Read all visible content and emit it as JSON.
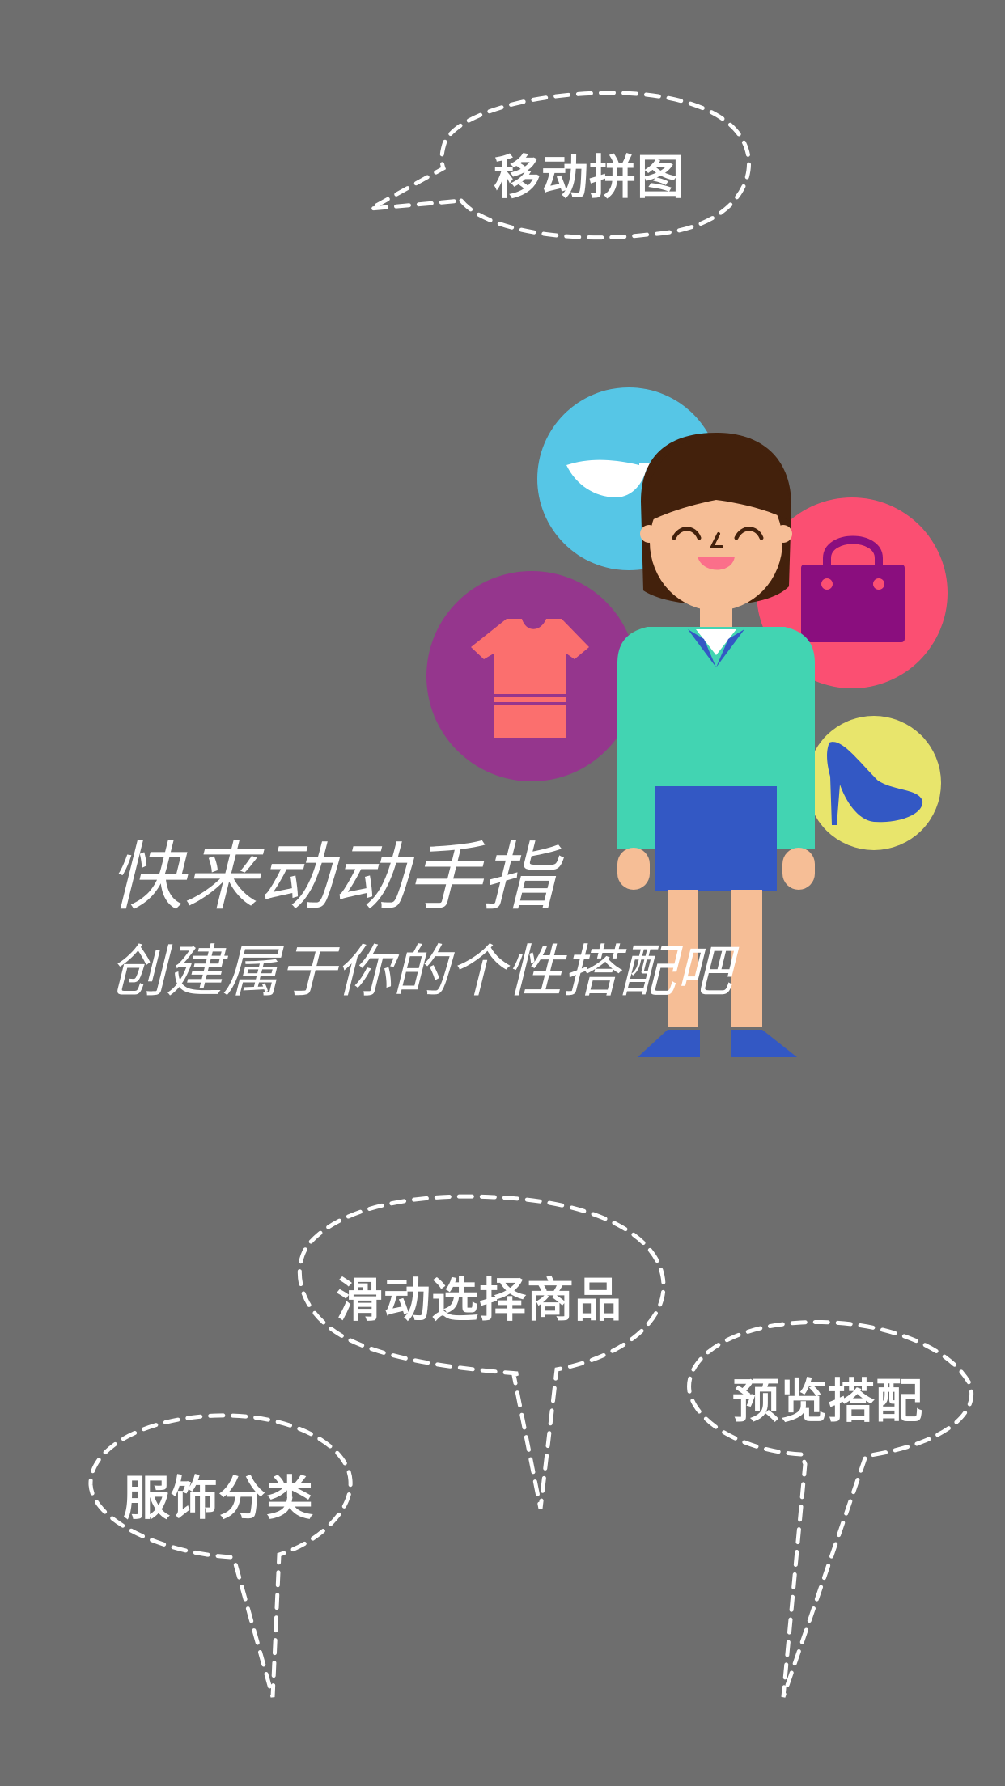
{
  "background": "#6e6e6e",
  "bubbles": {
    "top": "移动拼图",
    "middle": "滑动选择商品",
    "right": "预览搭配",
    "left": "服饰分类"
  },
  "headline": {
    "line1": "快来动动手指",
    "line2": "创建属于你的个性搭配吧"
  },
  "icons": {
    "glasses": "sunglasses-icon",
    "bag": "handbag-icon",
    "shirt": "tshirt-icon",
    "heel": "high-heel-icon"
  },
  "colors": {
    "glasses_circle": "#56c6e6",
    "bag_circle": "#fb4f72",
    "shirt_circle": "#95368d",
    "heel_circle": "#e8e56c",
    "top": "#42d4b2",
    "skirt": "#3358c4",
    "hair": "#43210c",
    "skin": "#f6be96"
  }
}
